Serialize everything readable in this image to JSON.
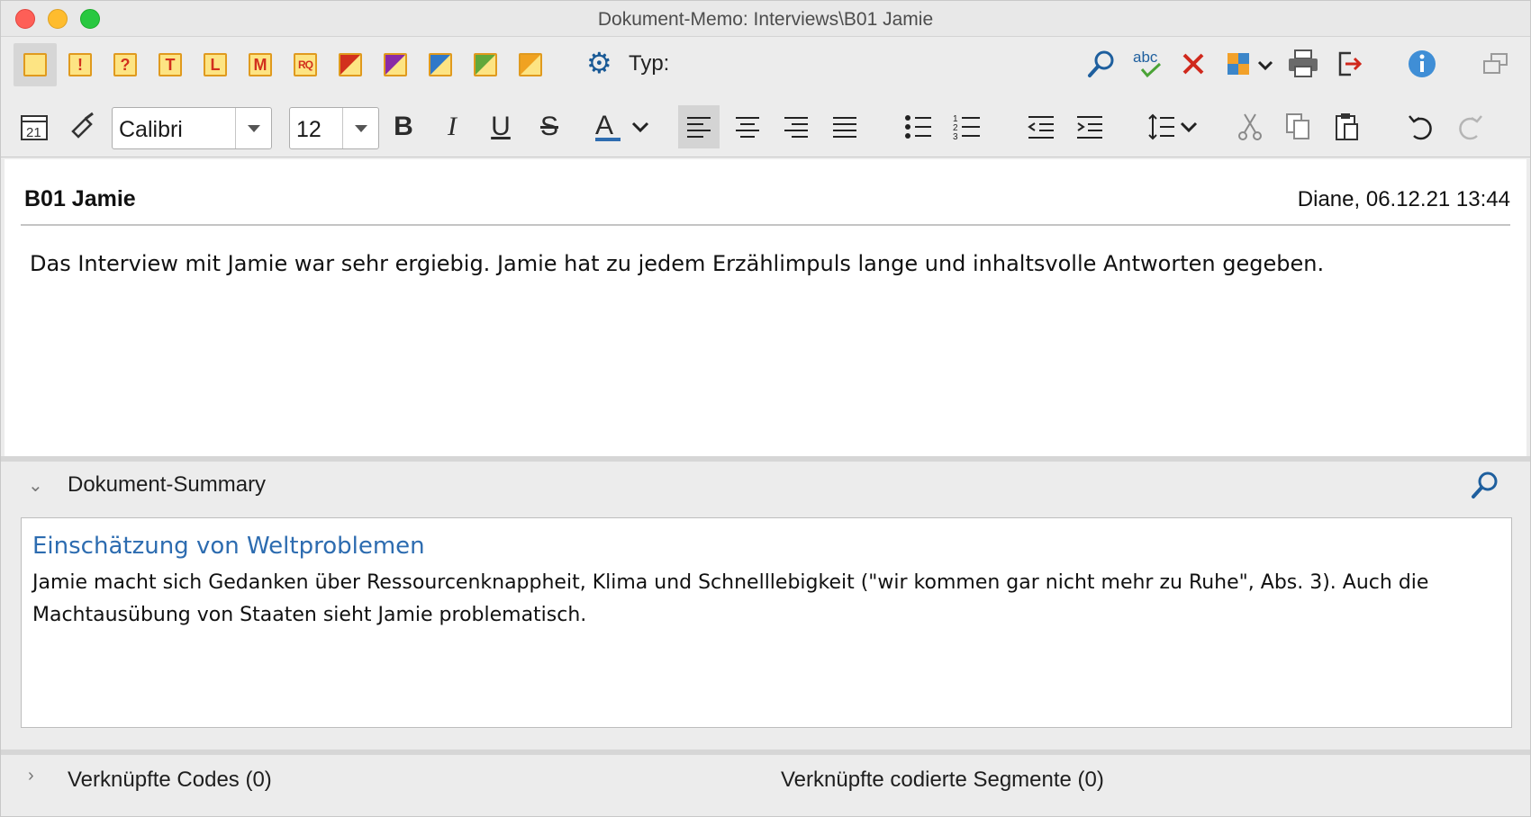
{
  "window": {
    "title": "Dokument-Memo: Interviews\\B01 Jamie"
  },
  "memo_types": {
    "items": [
      {
        "name": "standard",
        "glyph": ""
      },
      {
        "name": "exclamation",
        "glyph": "!"
      },
      {
        "name": "question",
        "glyph": "?"
      },
      {
        "name": "theory",
        "glyph": "T"
      },
      {
        "name": "literature",
        "glyph": "L"
      },
      {
        "name": "method",
        "glyph": "M"
      },
      {
        "name": "research-question",
        "glyph": "RQ"
      }
    ],
    "colored": [
      {
        "name": "red",
        "color": "#d2301d"
      },
      {
        "name": "purple",
        "color": "#8a2aa6"
      },
      {
        "name": "blue",
        "color": "#2f78c8"
      },
      {
        "name": "green",
        "color": "#62a83a"
      },
      {
        "name": "orange",
        "color": "#f0a221"
      }
    ],
    "type_label": "Typ:"
  },
  "format": {
    "font": "Calibri",
    "size": "12"
  },
  "memo": {
    "title": "B01 Jamie",
    "meta": "Diane, 06.12.21 13:44",
    "body": "Das Interview mit Jamie war sehr ergiebig. Jamie hat zu jedem Erzählimpuls lange und inhaltsvolle Antworten gegeben."
  },
  "summary": {
    "section_label": "Dokument-Summary",
    "heading": "Einschätzung von Weltproblemen",
    "text": "Jamie macht sich Gedanken über Ressourcenknappheit, Klima und Schnelllebigkeit (\"wir kommen gar nicht mehr zu Ruhe\", Abs. 3). Auch die Machtausübung von Staaten sieht Jamie problematisch."
  },
  "linked": {
    "codes": "Verknüpfte Codes (0)",
    "segments": "Verknüpfte codierte Segmente (0)"
  },
  "colors": {
    "accent": "#2d6cb0",
    "memo_yellow": "#fde483",
    "memo_border": "#e09a1e"
  }
}
